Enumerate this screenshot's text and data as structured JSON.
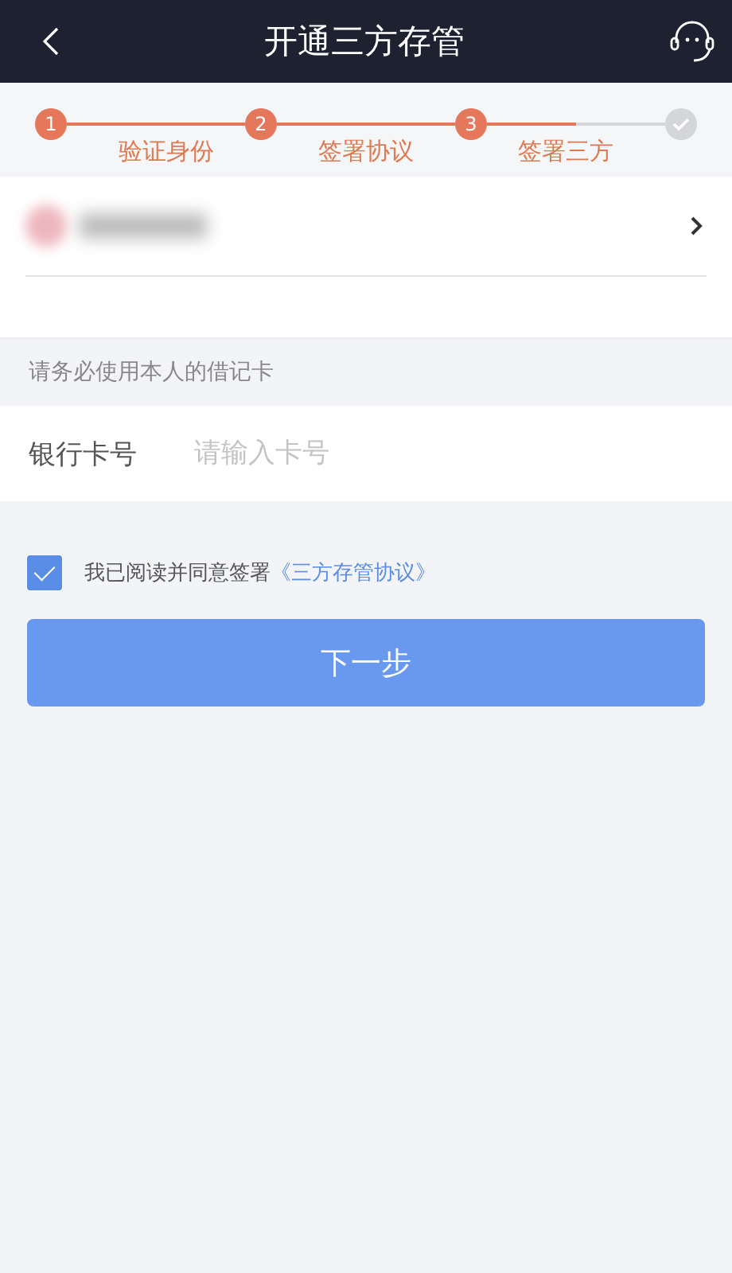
{
  "header": {
    "title": "开通三方存管"
  },
  "steps": [
    {
      "number": "1",
      "label": "验证身份",
      "done": true
    },
    {
      "number": "2",
      "label": "签署协议",
      "done": true
    },
    {
      "number": "3",
      "label": "签署三方",
      "done": true
    },
    {
      "done": false
    }
  ],
  "notice": "请务必使用本人的借记卡",
  "card_field": {
    "label": "银行卡号",
    "placeholder": "请输入卡号"
  },
  "agreement": {
    "checked": true,
    "text": "我已阅读并同意签署",
    "link": "《三方存管协议》"
  },
  "next_button": "下一步"
}
